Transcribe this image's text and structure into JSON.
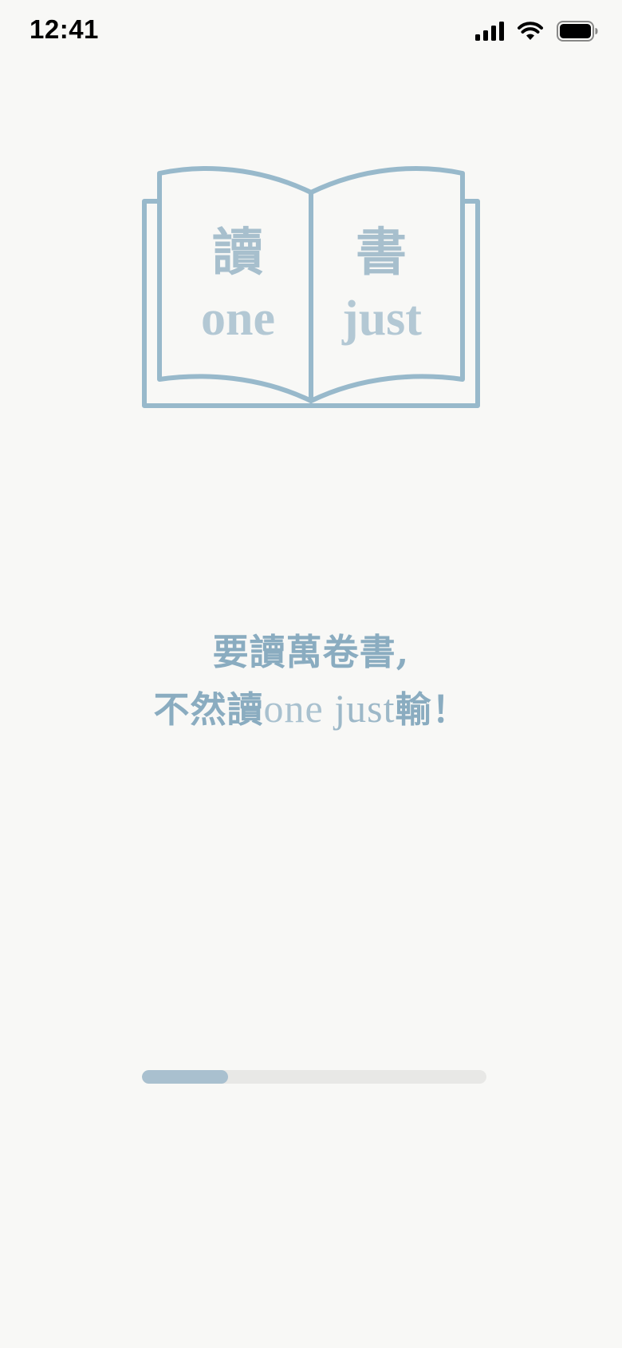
{
  "status_bar": {
    "time": "12:41"
  },
  "logo": {
    "char_left": "讀",
    "char_right": "書",
    "word_left": "one",
    "word_right": "just"
  },
  "tagline": {
    "line1": "要讀萬卷書,",
    "line2_prefix": "不然讀",
    "line2_word1": "one",
    "line2_space": " ",
    "line2_word2": "just",
    "line2_suffix": "輸！"
  },
  "progress": {
    "value": 0.25
  },
  "colors": {
    "background": "#f8f8f6",
    "accent": "#98b9cb",
    "text_muted": "#8aacc0"
  },
  "icons": [
    "cellular-signal-icon",
    "wifi-icon",
    "battery-icon"
  ]
}
